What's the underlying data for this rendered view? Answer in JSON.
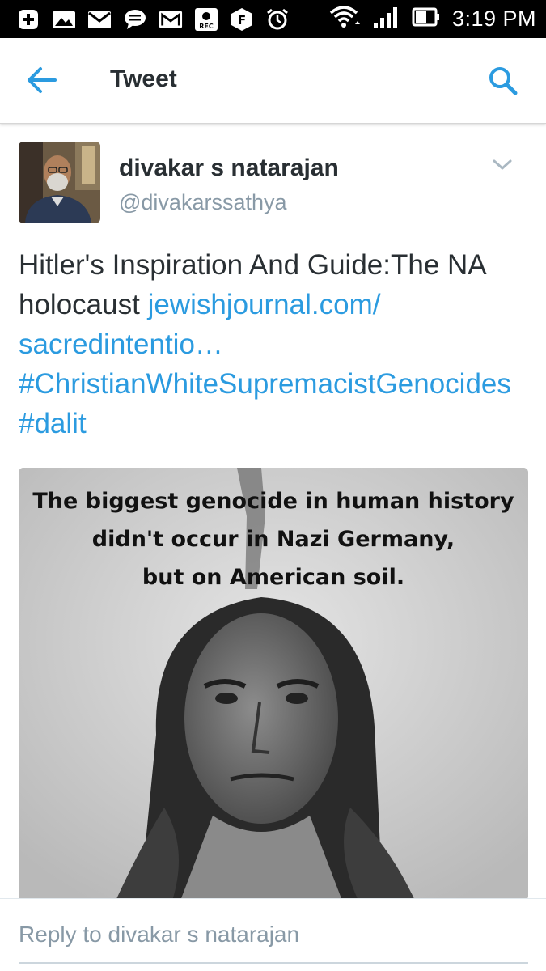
{
  "status_bar": {
    "time": "3:19 PM",
    "icons": [
      "add-icon",
      "image-icon",
      "mail-icon",
      "message-icon",
      "gmail-icon",
      "recorder-icon",
      "facebook-icon",
      "alarm-icon",
      "wifi-icon",
      "signal-icon",
      "battery-icon"
    ],
    "recorder_label": "REC",
    "facebook_label": "F"
  },
  "app_bar": {
    "title": "Tweet",
    "accent_color": "#2b9be0"
  },
  "tweet": {
    "author_name": "divakar s natarajan",
    "author_handle": "@divakarssathya",
    "text_before_link": "Hitler's Inspiration And Guide:The NA holocaust ",
    "link_text": "jewishjournal.com/ sacredintentio…",
    "hashtag_1": "#ChristianWhiteSupremacistGenocides",
    "hashtag_2": "#dalit",
    "image_caption_line1": "The biggest genocide in human history",
    "image_caption_line2": "didn't occur in Nazi Germany,",
    "image_caption_line3": "but on American soil."
  },
  "reply": {
    "placeholder": "Reply to divakar s natarajan"
  }
}
